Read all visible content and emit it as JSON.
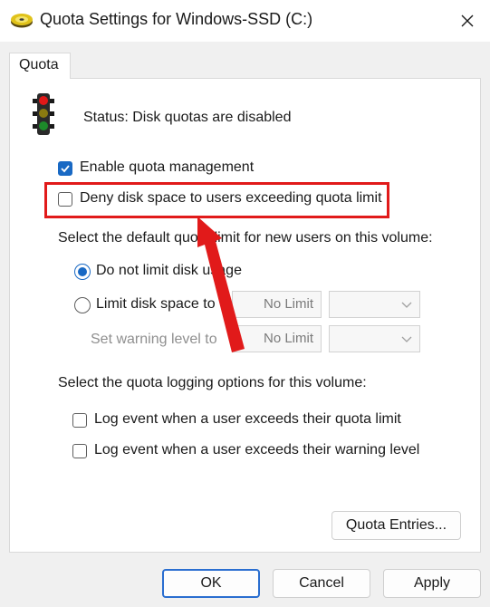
{
  "window": {
    "title": "Quota Settings for Windows-SSD (C:)"
  },
  "icons": {
    "app": "disk-drive-icon",
    "close": "close-icon",
    "status": "traffic-light-icon",
    "dropdown": "chevron-down-icon"
  },
  "tab": {
    "label": "Quota"
  },
  "status": {
    "text": "Status:  Disk quotas are disabled"
  },
  "options": {
    "enable_quota": {
      "label": "Enable quota management",
      "checked": true
    },
    "deny_space": {
      "label": "Deny disk space to users exceeding quota limit",
      "checked": false
    }
  },
  "default_quota": {
    "heading": "Select the default quota limit for new users on this volume:",
    "no_limit": {
      "label": "Do not limit disk usage",
      "selected": true
    },
    "limit": {
      "label": "Limit disk space to",
      "value": "No Limit",
      "unit": ""
    },
    "warning": {
      "label": "Set warning level to",
      "value": "No Limit",
      "unit": ""
    }
  },
  "logging": {
    "heading": "Select the quota logging options for this volume:",
    "log_limit": {
      "label": "Log event when a user exceeds their quota limit",
      "checked": false
    },
    "log_warning": {
      "label": "Log event when a user exceeds their warning level",
      "checked": false
    }
  },
  "buttons": {
    "quota_entries": "Quota Entries...",
    "ok": "OK",
    "cancel": "Cancel",
    "apply": "Apply"
  },
  "annotation": {
    "color": "#e11a1a"
  },
  "colors": {
    "accent": "#1969c4"
  }
}
